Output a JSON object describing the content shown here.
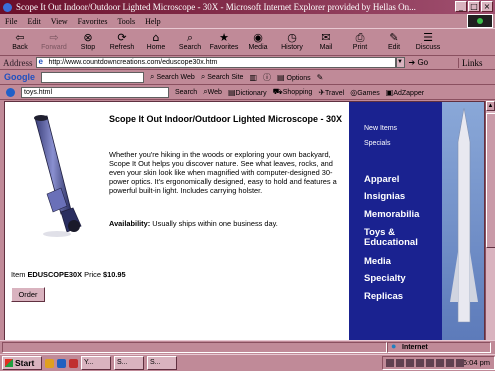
{
  "window": {
    "title": "Scope It Out Indoor/Outdoor Lighted Microscope - 30X - Microsoft Internet Explorer provided by Hellas On...",
    "controls": [
      "_",
      "□",
      "×"
    ]
  },
  "menu": [
    "File",
    "Edit",
    "View",
    "Favorites",
    "Tools",
    "Help"
  ],
  "toolbar": [
    {
      "label": "Back",
      "icon": "⇦",
      "enabled": true
    },
    {
      "label": "Forward",
      "icon": "⇨",
      "enabled": false
    },
    {
      "label": "Stop",
      "icon": "⊗",
      "enabled": true
    },
    {
      "label": "Refresh",
      "icon": "⟳",
      "enabled": true
    },
    {
      "label": "Home",
      "icon": "⌂",
      "enabled": true
    },
    {
      "label": "Search",
      "icon": "⌕",
      "enabled": true
    },
    {
      "label": "Favorites",
      "icon": "★",
      "enabled": true
    },
    {
      "label": "Media",
      "icon": "◉",
      "enabled": true
    },
    {
      "label": "History",
      "icon": "◷",
      "enabled": true
    },
    {
      "label": "Mail",
      "icon": "✉",
      "enabled": true
    },
    {
      "label": "Print",
      "icon": "⎙",
      "enabled": true
    },
    {
      "label": "Edit",
      "icon": "✎",
      "enabled": true
    },
    {
      "label": "Discuss",
      "icon": "☰",
      "enabled": true
    }
  ],
  "address": {
    "label": "Address",
    "url": "http://www.countdowncreations.com/eduscope30x.htm",
    "go": "Go",
    "links": "Links"
  },
  "google_bar": {
    "logo": "Google",
    "search_web": "Search Web",
    "search_site": "Search Site",
    "options": "Options"
  },
  "search_bar": {
    "query": "toys.html",
    "buttons": [
      "Search",
      "Web",
      "Dictionary",
      "Shopping",
      "Travel",
      "Games",
      "AdZapper"
    ]
  },
  "product": {
    "title": "Scope It Out Indoor/Outdoor Lighted Microscope - 30X",
    "description": "Whether you're hiking in the woods or exploring your own backyard, Scope It Out helps you discover nature. See what leaves, rocks, and even your skin look like when magnified with computer-designed 30-power optics. It's ergonomically designed, easy to hold and features a powerful built-in light. Includes carrying holster.",
    "availability_label": "Availability:",
    "availability_value": "Usually ships within one business day.",
    "item_label": "Item",
    "item_code": "EDUSCOPE30X",
    "price_label": "Price",
    "price": "$10.95",
    "order_button": "Order"
  },
  "side_nav": {
    "small_items": [
      "New Items",
      "Specials"
    ],
    "large_items": [
      "Apparel",
      "Insignias",
      "Memorabilia",
      "Toys & Educational",
      "Media",
      "Specialty",
      "Replicas"
    ]
  },
  "status": {
    "zone": "Internet"
  },
  "taskbar": {
    "start": "Start",
    "tasks": [
      "Y...",
      "S...",
      "S..."
    ],
    "clock": "6:04 pm"
  },
  "colors": {
    "chrome": "#c08a98",
    "titlebar": "#6a0f2a",
    "side_panel": "#1a2290"
  }
}
